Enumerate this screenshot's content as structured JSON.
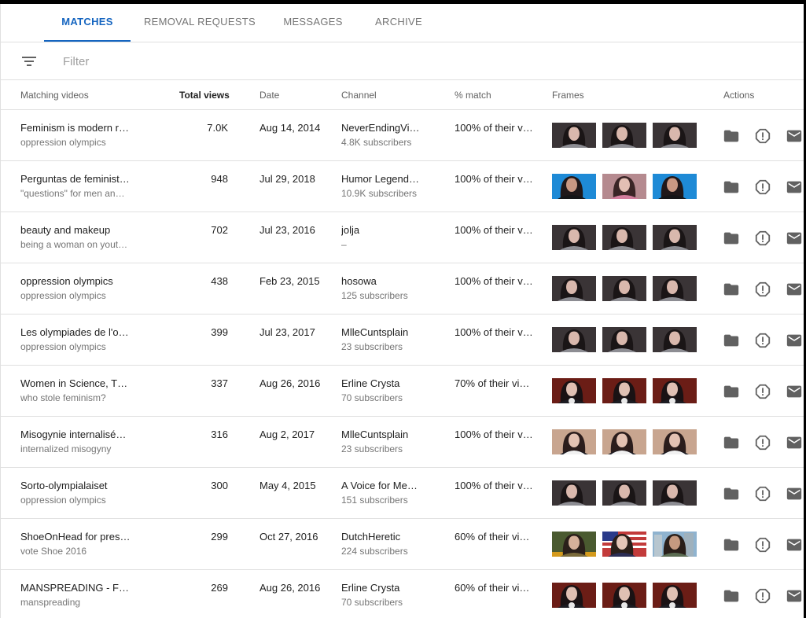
{
  "tabs": [
    {
      "label": "MATCHES",
      "active": true
    },
    {
      "label": "REMOVAL REQUESTS",
      "active": false
    },
    {
      "label": "MESSAGES",
      "active": false
    },
    {
      "label": "ARCHIVE",
      "active": false
    }
  ],
  "filter": {
    "placeholder": "Filter",
    "icon": "filter-list-icon"
  },
  "columns": {
    "video": "Matching videos",
    "views": "Total views",
    "date": "Date",
    "channel": "Channel",
    "match": "% match",
    "frames": "Frames",
    "actions": "Actions"
  },
  "actions_icons": [
    "folder-icon",
    "report-icon",
    "mail-icon"
  ],
  "colors": {
    "accent": "#1565c0",
    "icon": "#616161",
    "divider": "#e0e0e0"
  },
  "rows": [
    {
      "title": "Feminism is modern r…",
      "subtitle": "oppression olympics",
      "views": "7.0K",
      "date": "Aug 14, 2014",
      "channel": "NeverEndingVi…",
      "subscribers": "4.8K subscribers",
      "match": "100% of their vi…",
      "frames": [
        "dark",
        "dark",
        "dark"
      ]
    },
    {
      "title": "Perguntas de feminist…",
      "subtitle": "\"questions\" for men an…",
      "views": "948",
      "date": "Jul 29, 2018",
      "channel": "Humor Legend…",
      "subscribers": "10.9K subscribers",
      "match": "100% of their vi…",
      "frames": [
        "blue",
        "pink",
        "blue"
      ]
    },
    {
      "title": "beauty and makeup",
      "subtitle": "being a woman on yout…",
      "views": "702",
      "date": "Jul 23, 2016",
      "channel": "jolja",
      "subscribers": "–",
      "match": "100% of their vi…",
      "frames": [
        "dark",
        "dark",
        "dark"
      ]
    },
    {
      "title": "oppression olympics",
      "subtitle": "oppression olympics",
      "views": "438",
      "date": "Feb 23, 2015",
      "channel": "hosowa",
      "subscribers": "125 subscribers",
      "match": "100% of their vi…",
      "frames": [
        "dark",
        "dark",
        "dark"
      ]
    },
    {
      "title": "Les olympiades de l'o…",
      "subtitle": "oppression olympics",
      "views": "399",
      "date": "Jul 23, 2017",
      "channel": "MlleCuntsplain",
      "subscribers": "23 subscribers",
      "match": "100% of their vi…",
      "frames": [
        "dark",
        "dark",
        "dark"
      ]
    },
    {
      "title": "Women in Science, Th…",
      "subtitle": "who stole feminism?",
      "views": "337",
      "date": "Aug 26, 2016",
      "channel": "Erline Crysta",
      "subscribers": "70 subscribers",
      "match": "70% of their vid…",
      "frames": [
        "red",
        "red",
        "red"
      ]
    },
    {
      "title": "Misogynie internalisé…",
      "subtitle": "internalized misogyny",
      "views": "316",
      "date": "Aug 2, 2017",
      "channel": "MlleCuntsplain",
      "subscribers": "23 subscribers",
      "match": "100% of their vi…",
      "frames": [
        "light",
        "light",
        "light"
      ]
    },
    {
      "title": "Sorto-olympialaiset",
      "subtitle": "oppression olympics",
      "views": "300",
      "date": "May 4, 2015",
      "channel": "A Voice for Me…",
      "subscribers": "151 subscribers",
      "match": "100% of their vi…",
      "frames": [
        "dark",
        "dark",
        "dark"
      ]
    },
    {
      "title": "ShoeOnHead for presi…",
      "subtitle": "vote Shoe 2016",
      "views": "299",
      "date": "Oct 27, 2016",
      "channel": "DutchHeretic",
      "subscribers": "224 subscribers",
      "match": "60% of their vid…",
      "frames": [
        "green",
        "flag",
        "city"
      ]
    },
    {
      "title": "MANSPREADING - Fe…",
      "subtitle": "manspreading",
      "views": "269",
      "date": "Aug 26, 2016",
      "channel": "Erline Crysta",
      "subscribers": "70 subscribers",
      "match": "60% of their vid…",
      "frames": [
        "red",
        "red",
        "red"
      ]
    }
  ]
}
